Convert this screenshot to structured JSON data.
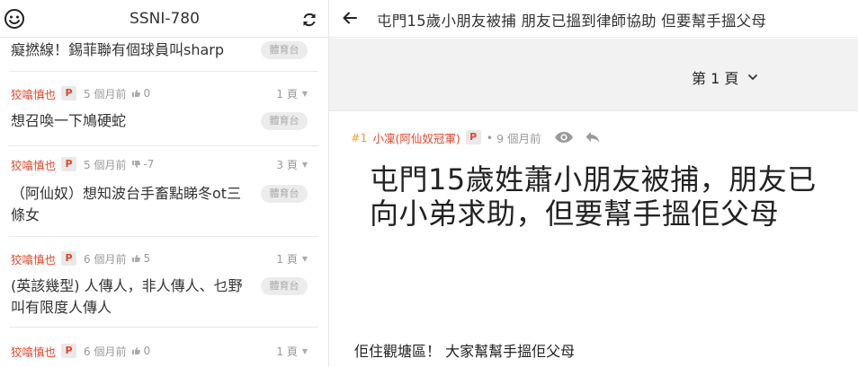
{
  "board": {
    "title": "SSNI-780"
  },
  "threads": [
    {
      "author": "",
      "badge": "",
      "time": "",
      "votes": "",
      "vote_type": "",
      "pages": "",
      "title": "癡撚線！錫菲聯有個球員叫sharp",
      "tag": "體育台"
    },
    {
      "author": "狡噏慎也",
      "badge": "P",
      "time": "5 個月前",
      "votes": "0",
      "vote_type": "up",
      "pages": "1 頁",
      "title": "想召喚一下鳩硬蛇",
      "tag": "體育台"
    },
    {
      "author": "狡噏慎也",
      "badge": "P",
      "time": "5 個月前",
      "votes": "-7",
      "vote_type": "down",
      "pages": "3 頁",
      "title": "（阿仙奴）想知波台手畜點睇冬ot三條女",
      "tag": "體育台"
    },
    {
      "author": "狡噏慎也",
      "badge": "P",
      "time": "6 個月前",
      "votes": "5",
      "vote_type": "up",
      "pages": "1 頁",
      "title": "(英該幾型) 人傳人，非人傳人、乜野叫有限度人傳人",
      "tag": "體育台"
    },
    {
      "author": "狡噏慎也",
      "badge": "P",
      "time": "6 個月前",
      "votes": "0",
      "vote_type": "up",
      "pages": "1 頁",
      "title": "",
      "tag": ""
    }
  ],
  "post": {
    "title": "屯門15歲小朋友被捕 朋友已搵到律師協助 但要幫手搵父母",
    "page_label": "第 1 頁",
    "floor": "#1",
    "author": "小凜(阿仙奴冠軍)",
    "badge": "P",
    "time": "9 個月前",
    "heading": "屯門15歲姓蕭小朋友被捕，朋友已向小弟求助，但要幫手搵佢父母",
    "body": "佢住觀塘區！ 大家幫幫手搵佢父母"
  },
  "icons": {
    "board": "smiley-icon",
    "refresh": "refresh-icon",
    "back": "back-arrow-icon",
    "upvote": "thumbs-up-icon",
    "downvote": "thumbs-down-icon",
    "view": "eye-icon",
    "reply": "reply-icon",
    "page_select": "chevron-down-icon"
  },
  "colors": {
    "author": "#e0472b",
    "floor": "#e8a23a",
    "page_band": "#f2f2f2",
    "tag_bg": "#ececec"
  }
}
